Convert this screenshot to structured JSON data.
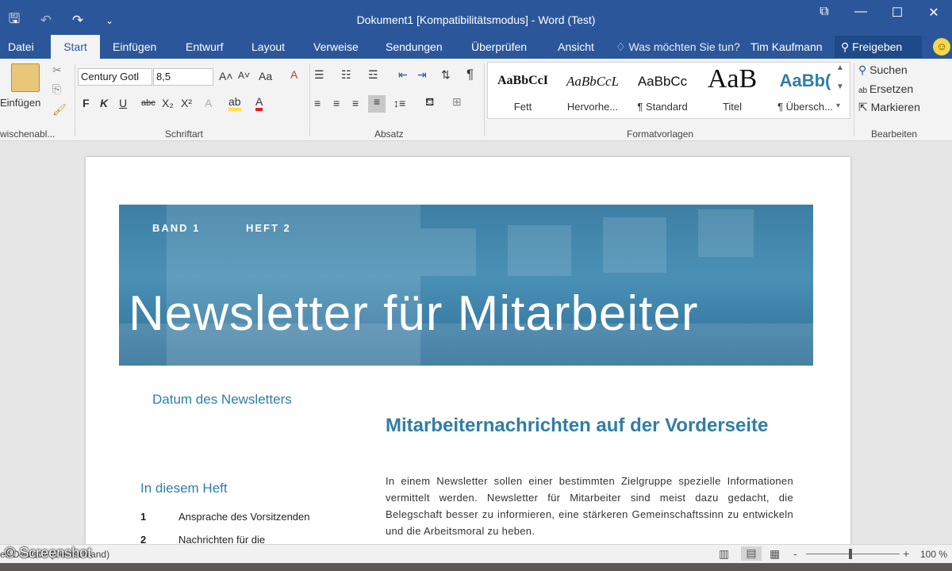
{
  "window": {
    "title": "Dokument1 [Kompatibilitätsmodus] - Word (Test)"
  },
  "qat": {
    "save_icon": "save-icon",
    "undo_icon": "undo-icon",
    "redo_icon": "redo-icon",
    "customize_icon": "customize-icon"
  },
  "tabs": [
    "Datei",
    "Start",
    "Einfügen",
    "Entwurf",
    "Layout",
    "Verweise",
    "Sendungen",
    "Überprüfen",
    "Ansicht"
  ],
  "active_tab": "Start",
  "tell_me": "Was möchten Sie tun?",
  "user": "Tim Kaufmann",
  "share_label": "Freigeben",
  "ribbon": {
    "clipboard": {
      "paste_label": "Einfügen",
      "group_label": "wischenabl..."
    },
    "font": {
      "font_name": "Century Gotl",
      "font_size": "8,5",
      "bold": "F",
      "italic": "K",
      "underline": "U",
      "strike": "abc",
      "subscript": "X₂",
      "superscript": "X²",
      "case": "Aa",
      "group_label": "Schriftart"
    },
    "paragraph": {
      "group_label": "Absatz",
      "pilcrow": "¶"
    },
    "styles": {
      "group_label": "Formatvorlagen",
      "items": [
        {
          "preview": "AaBbCcI",
          "name": "Fett"
        },
        {
          "preview": "AaBbCcL",
          "name": "Hervorhe..."
        },
        {
          "preview": "AaBbCc",
          "name": "¶ Standard"
        },
        {
          "preview": "AaB",
          "name": "Titel"
        },
        {
          "preview": "AaBb(",
          "name": "¶ Übersch..."
        }
      ]
    },
    "editing": {
      "group_label": "Bearbeiten",
      "find": "Suchen",
      "replace": "Ersetzen",
      "select": "Markieren"
    }
  },
  "document": {
    "band": "BAND 1",
    "heft": "HEFT 2",
    "banner_title": "Newsletter für Mitarbeiter",
    "date_label": "Datum des Newsletters",
    "in_issue": "In diesem Heft",
    "toc": [
      {
        "num": "1",
        "text": "Ansprache des Vorsitzenden"
      },
      {
        "num": "2",
        "text": "Nachrichten für die"
      }
    ],
    "heading": "Mitarbeiternachrichten auf der Vorderseite",
    "body": "In einem Newsletter sollen einer bestimmten Zielgruppe spezielle Informationen vermittelt werden. Newsletter für Mitarbeiter sind meist dazu gedacht, die Belegschaft besser zu informieren, eine stärkeren Gemeinschaftssinn zu entwickeln und die Arbeitsmoral zu heben."
  },
  "statusbar": {
    "language": "eit  Deutsch (Deutschland)",
    "watermark": "© Screenshot",
    "zoom": "100 %",
    "zoom_minus": "-",
    "zoom_plus": "+"
  },
  "colors": {
    "word_blue": "#2b579a",
    "accent_teal": "#2f7ea4"
  }
}
